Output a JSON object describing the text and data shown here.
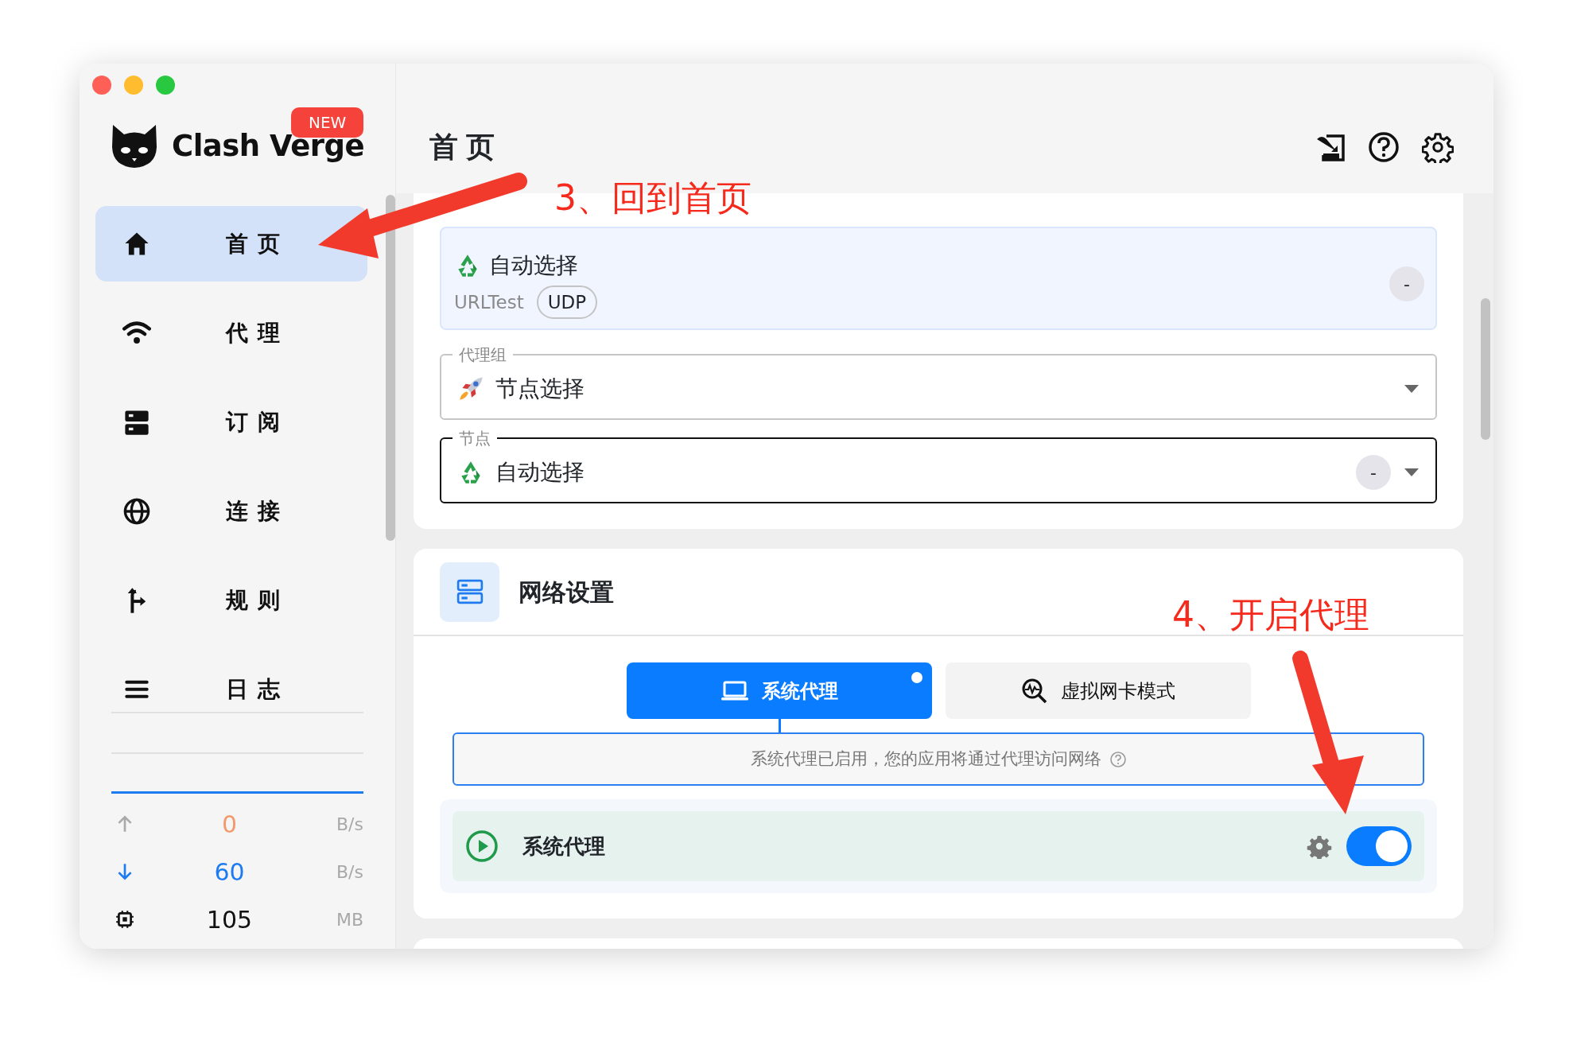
{
  "sidebar": {
    "logo_text": "Clash Verge",
    "badge": "NEW",
    "items": [
      {
        "label": "首页",
        "selected": true
      },
      {
        "label": "代理",
        "selected": false
      },
      {
        "label": "订阅",
        "selected": false
      },
      {
        "label": "连接",
        "selected": false
      },
      {
        "label": "规则",
        "selected": false
      },
      {
        "label": "日志",
        "selected": false
      }
    ],
    "stats": [
      {
        "kind": "upload",
        "value": "0",
        "unit": "B/s"
      },
      {
        "kind": "download",
        "value": "60",
        "unit": "B/s"
      },
      {
        "kind": "memory",
        "value": "105",
        "unit": "MB"
      }
    ]
  },
  "header": {
    "title": "首页"
  },
  "proxy_card": {
    "group": {
      "name": "自动选择",
      "type": "URLTest",
      "tag": "UDP",
      "delay": "-"
    },
    "fields": [
      {
        "label": "代理组",
        "value": "节点选择",
        "focused": false
      },
      {
        "label": "节点",
        "value": "自动选择",
        "delay": "-",
        "focused": true
      }
    ]
  },
  "network_card": {
    "title": "网络设置",
    "tabs": [
      {
        "label": "系统代理",
        "selected": true,
        "running": true
      },
      {
        "label": "虚拟网卡模式",
        "selected": false,
        "running": false
      }
    ],
    "info": "系统代理已启用，您的应用将通过代理访问网络",
    "switch": {
      "label": "系统代理",
      "on": true
    }
  },
  "annotations": [
    {
      "text": "3、回到首页"
    },
    {
      "text": "4、开启代理"
    }
  ]
}
